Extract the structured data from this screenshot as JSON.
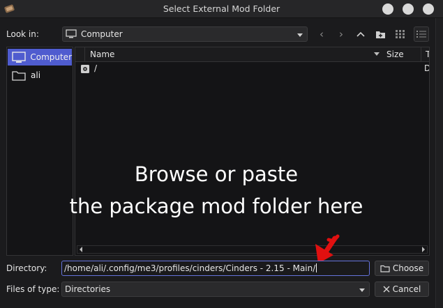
{
  "window": {
    "title": "Select External Mod Folder"
  },
  "lookin": {
    "label": "Look in:",
    "value": "Computer"
  },
  "sidebar": {
    "items": [
      {
        "label": "Computer",
        "selected": true
      },
      {
        "label": "ali",
        "selected": false
      }
    ]
  },
  "filelist": {
    "headers": {
      "name": "Name",
      "size": "Size",
      "type": "Ty"
    },
    "rows": [
      {
        "name": "/",
        "type": "D"
      }
    ]
  },
  "overlay": {
    "line1": "Browse or paste",
    "line2": "the package mod folder here"
  },
  "directory": {
    "label": "Directory:",
    "value": "/home/ali/.config/me3/profiles/cinders/Cinders - 2.15 - Main/"
  },
  "filetype": {
    "label": "Files of type:",
    "value": "Directories"
  },
  "buttons": {
    "choose": "Choose",
    "cancel": "Cancel"
  },
  "colors": {
    "accent": "#4f5ccf",
    "annotation": "#e01010",
    "background": "#1b1b1d"
  }
}
